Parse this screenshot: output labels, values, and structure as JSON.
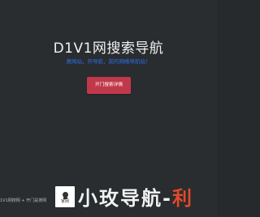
{
  "hero": {
    "title": "D1V1网搜索导航",
    "subtitle": "黄网站，开导航，前的网络导航站！",
    "button_label": "开门搜索详情"
  },
  "footer": {
    "text": "1V1网搜网 + 开门是搜网",
    "home_label": "官网"
  },
  "watermark": {
    "part_one": "小玫导航-",
    "part_two": "利"
  },
  "colors": {
    "background": "#292d30",
    "subtitle": "#2a6ee8",
    "button": "#c0394b"
  }
}
